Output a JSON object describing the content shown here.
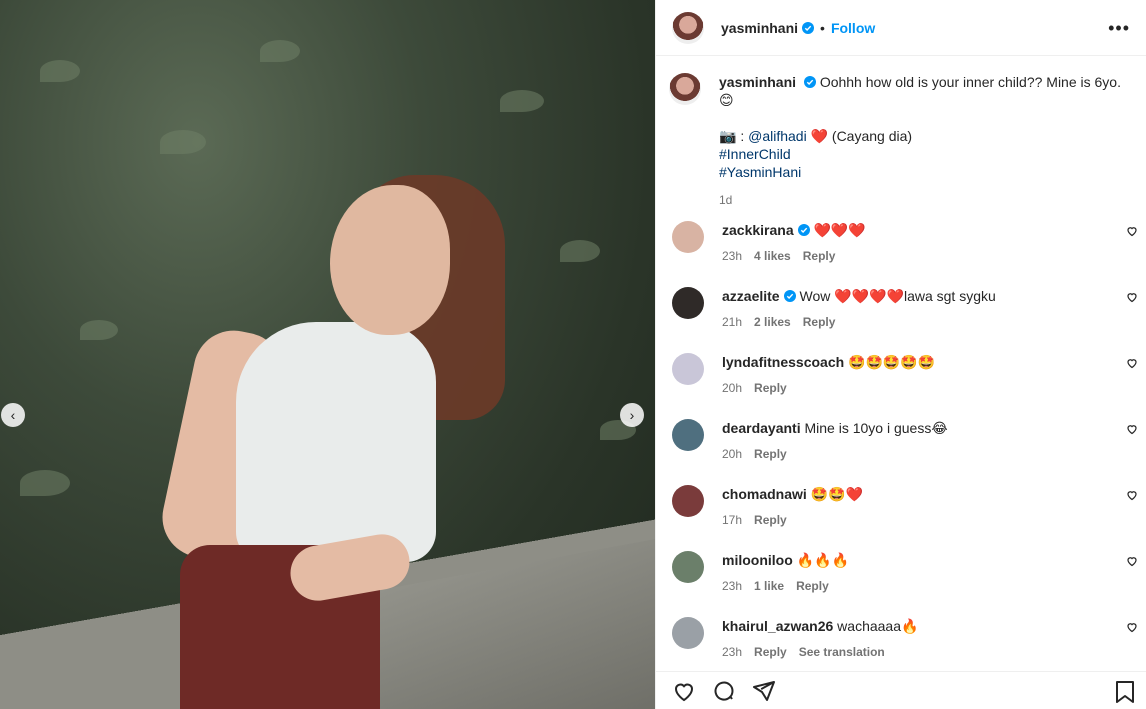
{
  "post": {
    "username": "yasminhani",
    "follow_label": "Follow",
    "dot": "•",
    "more_label": "•••"
  },
  "caption": {
    "username": "yasminhani",
    "line1": "Oohhh how old is your inner child?? Mine is 6yo.",
    "emoji1": "😊",
    "photo_credit_prefix": "📷 : ",
    "mention": "@alifhadi",
    "heart": "❤️",
    "credit_suffix": " (Cayang dia)",
    "hashtag1": "#InnerChild",
    "hashtag2": "#YasminHani",
    "age": "1d"
  },
  "comments": [
    {
      "user": "zackkirana",
      "verified": true,
      "text": "❤️❤️❤️",
      "time": "23h",
      "likes": "4 likes",
      "reply": "Reply",
      "avatar_color": "#d8b3a3"
    },
    {
      "user": "azzaelite",
      "verified": true,
      "text": "Wow ❤️❤️❤️❤️lawa sgt sygku",
      "time": "21h",
      "likes": "2 likes",
      "reply": "Reply",
      "avatar_color": "#2f2a28"
    },
    {
      "user": "lyndafitnesscoach",
      "verified": false,
      "text": "🤩🤩🤩🤩🤩",
      "time": "20h",
      "likes": "",
      "reply": "Reply",
      "avatar_color": "#c9c6d8"
    },
    {
      "user": "deardayanti",
      "verified": false,
      "text": "Mine is 10yo i guess😂",
      "time": "20h",
      "likes": "",
      "reply": "Reply",
      "avatar_color": "#4f6f7f"
    },
    {
      "user": "chomadnawi",
      "verified": false,
      "text": "🤩🤩❤️",
      "time": "17h",
      "likes": "",
      "reply": "Reply",
      "avatar_color": "#7a3b3b"
    },
    {
      "user": "milooniloo",
      "verified": false,
      "text": "🔥🔥🔥",
      "time": "23h",
      "likes": "1 like",
      "reply": "Reply",
      "avatar_color": "#6b7f6a"
    },
    {
      "user": "khairul_azwan26",
      "verified": false,
      "text": "wachaaaa🔥",
      "time": "23h",
      "likes": "",
      "reply": "Reply",
      "extra": "See translation",
      "avatar_color": "#9aa0a6"
    }
  ],
  "photo": {
    "prev_label": "‹",
    "next_label": "›"
  }
}
